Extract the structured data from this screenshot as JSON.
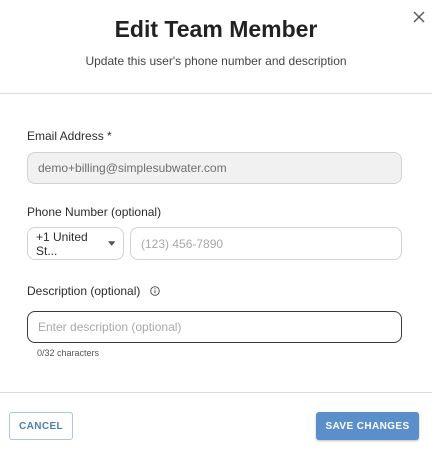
{
  "dialog": {
    "title": "Edit Team Member",
    "subtitle": "Update this user's phone number and description",
    "close_icon": "close-icon"
  },
  "form": {
    "email": {
      "label": "Email Address *",
      "value": "demo+billing@simplesubwater.com"
    },
    "phone": {
      "label": "Phone Number (optional)",
      "country_value": "+1 United St...",
      "placeholder": "(123) 456-7890"
    },
    "description": {
      "label": "Description (optional)",
      "info_icon": "info-icon",
      "placeholder": "Enter description (optional)",
      "char_count": "0/32 characters"
    }
  },
  "actions": {
    "cancel_label": "CANCEL",
    "save_label": "SAVE CHANGES"
  },
  "colors": {
    "primary": "#5b8fcb",
    "cancel_text": "#4a7fb8",
    "disabled_bg": "#f1f1f1"
  }
}
